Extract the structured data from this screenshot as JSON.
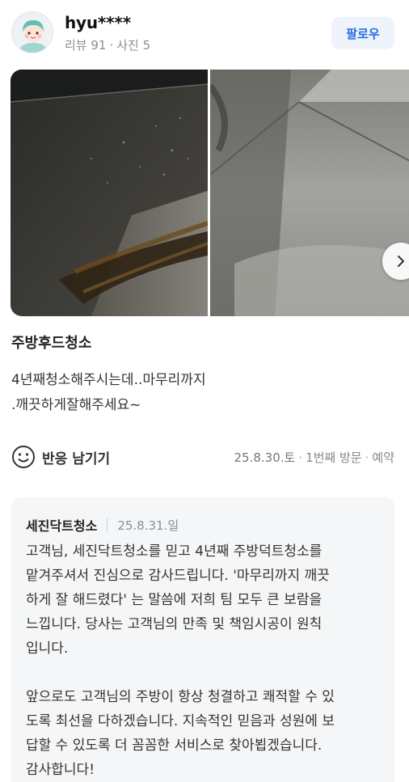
{
  "user": {
    "name": "hyu****",
    "reviews_label": "리뷰 91",
    "photos_label": "사진 5",
    "separator": "·"
  },
  "follow_label": "팔로우",
  "review": {
    "title": "주방후드청소",
    "body_line1": "4년째청소해주시는데..마무리까지",
    "body_line2": ".깨끗하게잘해주세요~"
  },
  "reaction_label": "반응 남기기",
  "visit": {
    "date": "25.8.30.토",
    "count": "1번째 방문",
    "type": "예약"
  },
  "reply": {
    "owner": "세진닥트청소",
    "date": "25.8.31.일",
    "paragraph1": "고객님, 세진닥트청소를 믿고 4년째 주방덕트청소를\n맡겨주셔서 진심으로 감사드립니다. '마무리까지 깨끗\n하게 잘 해드렸다' 는 말씀에 저희 팀 모두 큰 보람을\n느낍니다. 당사는 고객님의 만족 및 책임시공이 원칙\n입니다.",
    "paragraph2": "앞으로도 고객님의 주방이 항상 청결하고 쾌적할 수 있\n도록 최선을 다하겠습니다. 지속적인 믿음과 성원에 보\n답할 수 있도록 더 꼼꼼한 서비스로 찾아뵙겠습니다.\n감사합니다!"
  },
  "icons": {
    "avatar": "user-avatar-icon",
    "next": "chevron-right-icon",
    "reaction": "smiley-icon"
  },
  "colors": {
    "accent": "#2b6ee0",
    "follow_bg": "#eef3fc",
    "reply_bg": "#f5f6f7"
  }
}
